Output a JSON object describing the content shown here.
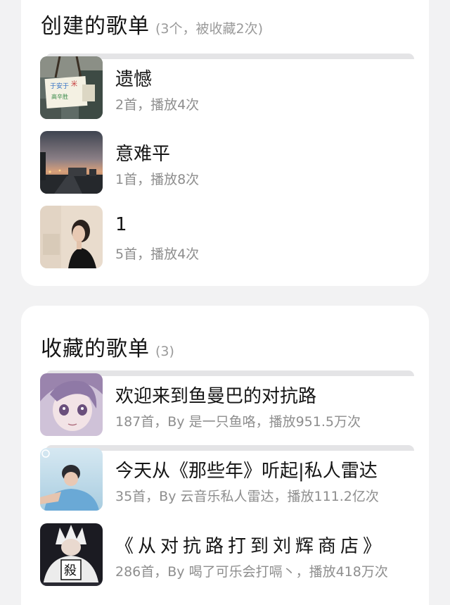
{
  "created": {
    "title": "创建的歌单",
    "count": "(3个，被收藏2次)",
    "items": [
      {
        "title": "遗憾",
        "sub": "2首，播放4次",
        "cover_icon": "handwritten-note-cover"
      },
      {
        "title": "意难平",
        "sub": "1首，播放8次",
        "cover_icon": "sunset-street-cover"
      },
      {
        "title": "1",
        "sub": "5首，播放4次",
        "cover_icon": "girl-portrait-cover"
      }
    ]
  },
  "collected": {
    "title": "收藏的歌单",
    "count": "(3)",
    "items": [
      {
        "title": "欢迎来到鱼曼巴的对抗路",
        "sub": "187首，By 是一只鱼咯，播放951.5万次",
        "cover_icon": "anime-girl-cover"
      },
      {
        "title": "今天从《那些年》听起|私人雷达",
        "sub": "35首，By 云音乐私人雷达，播放111.2亿次",
        "cover_icon": "boy-portrait-cover"
      },
      {
        "title": "《从对抗路打到刘辉商店》",
        "sub": "286首，By 喝了可乐会打嗝丶，播放418万次",
        "cover_icon": "anime-character-cover"
      }
    ]
  },
  "colors": {
    "background": "#f2f2f3",
    "card": "#ffffff",
    "title_text": "#151515",
    "sub_text": "#8e8e8e"
  }
}
